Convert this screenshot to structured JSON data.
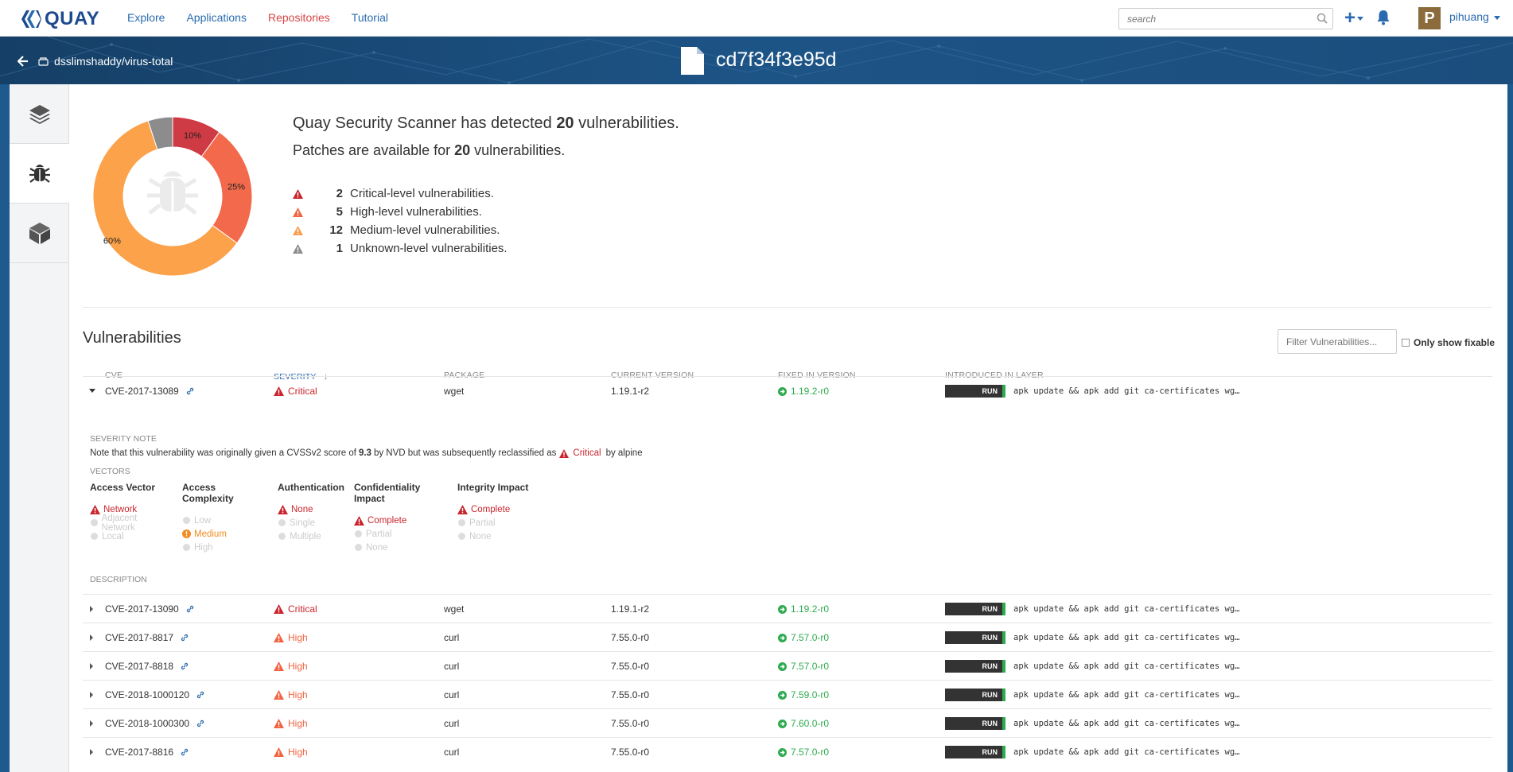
{
  "app": {
    "name": "QUAY"
  },
  "nav": {
    "explore": "Explore",
    "applications": "Applications",
    "repositories": "Repositories",
    "tutorial": "Tutorial"
  },
  "search": {
    "placeholder": "search"
  },
  "user": {
    "initial": "P",
    "name": "pihuang"
  },
  "header": {
    "repo": "dsslimshaddy/virus-total",
    "image_id": "cd7f34f3e95d"
  },
  "sidebar": {
    "tabs": [
      {
        "icon": "layers-icon"
      },
      {
        "icon": "bug-icon"
      },
      {
        "icon": "package-icon"
      }
    ]
  },
  "colors": {
    "critical": "#c9252d",
    "high": "#f06440",
    "medium": "#f89e4e",
    "unknown": "#8c8c8c",
    "fixed": "#2fab4f",
    "link": "#2a6bb0"
  },
  "summary": {
    "detected_prefix": "Quay Security Scanner has detected ",
    "detected_count": "20",
    "detected_suffix": " vulnerabilities.",
    "patches_prefix": "Patches are available for ",
    "patches_count": "20",
    "patches_suffix": " vulnerabilities.",
    "counts": [
      {
        "level": "critical",
        "count": "2",
        "label": "Critical-level vulnerabilities."
      },
      {
        "level": "high",
        "count": "5",
        "label": "High-level vulnerabilities."
      },
      {
        "level": "medium",
        "count": "12",
        "label": "Medium-level vulnerabilities."
      },
      {
        "level": "unknown",
        "count": "1",
        "label": "Unknown-level vulnerabilities."
      }
    ],
    "donut": [
      {
        "level": "critical",
        "fraction": 0.1,
        "label": "10%"
      },
      {
        "level": "high",
        "fraction": 0.25,
        "label": "25%"
      },
      {
        "level": "medium",
        "fraction": 0.6,
        "label": "60%"
      },
      {
        "level": "unknown",
        "fraction": 0.05,
        "label": ""
      }
    ]
  },
  "vulns": {
    "title": "Vulnerabilities",
    "filter_placeholder": "Filter Vulnerabilities...",
    "only_fixable": "Only show fixable",
    "headers": {
      "cve": "CVE",
      "severity": "SEVERITY",
      "sort_arrow": "↓",
      "package": "PACKAGE",
      "current": "CURRENT VERSION",
      "fixed": "FIXED IN VERSION",
      "layer": "INTRODUCED IN LAYER"
    },
    "run": "RUN",
    "command": "apk update && apk add git ca-certificates wg…",
    "rows": [
      {
        "cve": "CVE-2017-13089",
        "severity": "Critical",
        "level": "critical",
        "package": "wget",
        "current": "1.19.1-r2",
        "fixed": "1.19.2-r0",
        "expanded": true
      },
      {
        "cve": "CVE-2017-13090",
        "severity": "Critical",
        "level": "critical",
        "package": "wget",
        "current": "1.19.1-r2",
        "fixed": "1.19.2-r0"
      },
      {
        "cve": "CVE-2017-8817",
        "severity": "High",
        "level": "high",
        "package": "curl",
        "current": "7.55.0-r0",
        "fixed": "7.57.0-r0"
      },
      {
        "cve": "CVE-2017-8818",
        "severity": "High",
        "level": "high",
        "package": "curl",
        "current": "7.55.0-r0",
        "fixed": "7.57.0-r0"
      },
      {
        "cve": "CVE-2018-1000120",
        "severity": "High",
        "level": "high",
        "package": "curl",
        "current": "7.55.0-r0",
        "fixed": "7.59.0-r0"
      },
      {
        "cve": "CVE-2018-1000300",
        "severity": "High",
        "level": "high",
        "package": "curl",
        "current": "7.55.0-r0",
        "fixed": "7.60.0-r0"
      },
      {
        "cve": "CVE-2017-8816",
        "severity": "High",
        "level": "high",
        "package": "curl",
        "current": "7.55.0-r0",
        "fixed": "7.57.0-r0"
      }
    ],
    "detail": {
      "severity_note_label": "SEVERITY NOTE",
      "note_prefix": "Note that this vulnerability was originally given a CVSSv2 score of ",
      "note_score": "9.3",
      "note_middle": " by NVD but was subsequently reclassified as ",
      "note_severity": "Critical",
      "note_suffix": " by alpine",
      "vectors_label": "VECTORS",
      "description_label": "DESCRIPTION",
      "vectors": [
        {
          "name": "Access Vector",
          "options": [
            {
              "label": "Network",
              "state": "critical"
            },
            {
              "label": "Adjacent Network",
              "state": "off"
            },
            {
              "label": "Local",
              "state": "off"
            }
          ]
        },
        {
          "name": "Access Complexity",
          "options": [
            {
              "label": "Low",
              "state": "off"
            },
            {
              "label": "Medium",
              "state": "medium"
            },
            {
              "label": "High",
              "state": "off"
            }
          ]
        },
        {
          "name": "Authentication",
          "options": [
            {
              "label": "None",
              "state": "critical"
            },
            {
              "label": "Single",
              "state": "off"
            },
            {
              "label": "Multiple",
              "state": "off"
            }
          ]
        },
        {
          "name": "Confidentiality Impact",
          "options": [
            {
              "label": "Complete",
              "state": "critical"
            },
            {
              "label": "Partial",
              "state": "off"
            },
            {
              "label": "None",
              "state": "off"
            }
          ]
        },
        {
          "name": "Integrity Impact",
          "options": [
            {
              "label": "Complete",
              "state": "critical"
            },
            {
              "label": "Partial",
              "state": "off"
            },
            {
              "label": "None",
              "state": "off"
            }
          ]
        }
      ]
    }
  }
}
